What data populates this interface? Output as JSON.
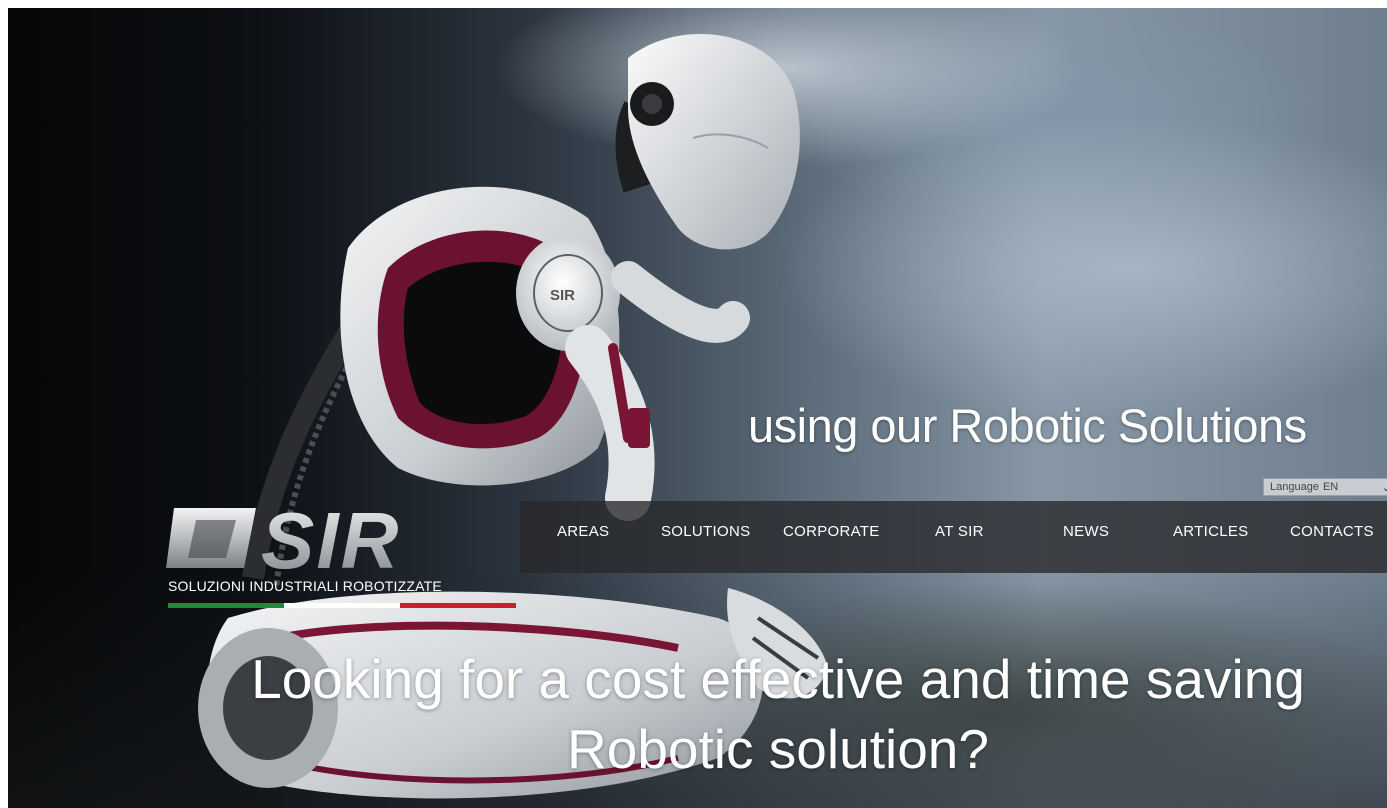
{
  "hero": {
    "tagline": "using our Robotic Solutions",
    "headline_line1": "Looking for a cost effective and time saving",
    "headline_line2": "Robotic solution?"
  },
  "language_selector": {
    "label": "Language",
    "selected": "EN"
  },
  "logo": {
    "mark": "SIR",
    "subtitle": "SOLUZIONI INDUSTRIALI ROBOTIZZATE",
    "flag_colors": [
      "#1e8a3a",
      "#ffffff",
      "#c8202c"
    ]
  },
  "nav": {
    "items": [
      {
        "label": "AREAS"
      },
      {
        "label": "SOLUTIONS"
      },
      {
        "label": "CORPORATE"
      },
      {
        "label": "AT SIR"
      },
      {
        "label": "NEWS"
      },
      {
        "label": "ARTICLES"
      },
      {
        "label": "CONTACTS"
      }
    ]
  },
  "icons": {
    "language_dropdown": "chevron-down-icon"
  },
  "colors": {
    "nav_background": "#28282a",
    "robot_accent": "#7a1535",
    "robot_body": "#e8eaec"
  }
}
